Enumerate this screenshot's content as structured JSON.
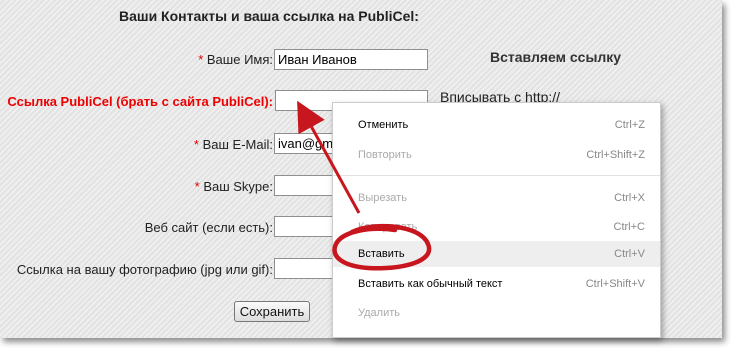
{
  "form": {
    "title": "Ваши Контакты и ваша ссылка на PubliCel:",
    "required_mark": "*",
    "name_label": "Ваше Имя:",
    "name_value": "Иван Иванов",
    "link_label": "Ссылка PubliCel (брать с сайта PubliCel):",
    "link_value": "",
    "email_label": "Ваш E-Mail:",
    "email_value": "ivan@gm",
    "skype_label": "Ваш Skype:",
    "skype_value": "",
    "website_label": "Веб сайт (если есть):",
    "website_value": "",
    "photo_label": "Ссылка на вашу фотографию (jpg или gif):",
    "photo_value": "",
    "save_label": "Сохранить"
  },
  "side": {
    "heading": "Вставляем ссылку",
    "hint": "Вписывать с http://"
  },
  "context_menu": {
    "items": [
      {
        "label": "Отменить",
        "shortcut": "Ctrl+Z",
        "disabled": false
      },
      {
        "label": "Повторить",
        "shortcut": "Ctrl+Shift+Z",
        "disabled": true
      },
      {
        "label": "Вырезать",
        "shortcut": "Ctrl+X",
        "disabled": true
      },
      {
        "label": "Копировать",
        "shortcut": "Ctrl+C",
        "disabled": true
      },
      {
        "label": "Вставить",
        "shortcut": "Ctrl+V",
        "disabled": false
      },
      {
        "label": "Вставить как обычный текст",
        "shortcut": "Ctrl+Shift+V",
        "disabled": false
      },
      {
        "label": "Удалить",
        "shortcut": "",
        "disabled": true
      }
    ]
  },
  "annotation_colors": {
    "arrow": "#c8161e",
    "circle": "#c8161e"
  }
}
